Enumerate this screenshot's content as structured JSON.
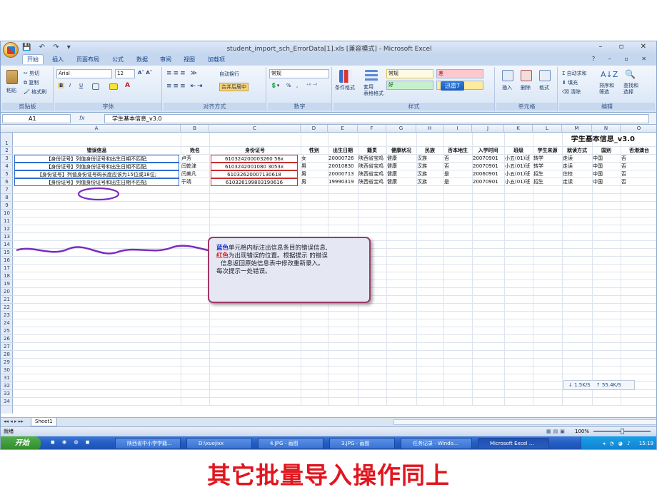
{
  "window": {
    "title": "student_import_sch_ErrorData[1].xls  [兼容模式] - Microsoft Excel",
    "controls": "– ▫ ✕",
    "qat": "💾 ↶ ↷ ▾"
  },
  "ribbon_tabs": [
    "开始",
    "插入",
    "页面布局",
    "公式",
    "数据",
    "审阅",
    "视图",
    "加载项"
  ],
  "ribbon_help": "? – ▫ ✕",
  "clipboard": {
    "paste": "粘贴",
    "cut": "剪切",
    "copy": "复制",
    "format_painter": "格式刷",
    "label": "剪贴板"
  },
  "font": {
    "name": "Arial",
    "size": "12",
    "bold": "B",
    "italic": "I",
    "underline": "U",
    "label": "字体"
  },
  "alignment": {
    "wrap": "自动换行",
    "merge": "合并后居中",
    "label": "对齐方式"
  },
  "number": {
    "format": "常规",
    "percent": "%",
    "comma": ",",
    "label": "数字"
  },
  "styles": {
    "cond": "条件格式",
    "table": "套用\n表格格式",
    "normal": "常规",
    "bad": "差",
    "good": "好",
    "label": "样式",
    "badge": "迅雷7"
  },
  "cells": {
    "insert": "插入",
    "delete": "删除",
    "format": "格式",
    "label": "单元格"
  },
  "editing": {
    "autosum": "自动求和",
    "fill": "填充",
    "clear": "清除",
    "sort": "排序和\n筛选",
    "find": "查找和\n选择",
    "label": "编辑"
  },
  "formula_bar": {
    "cell_ref": "A1",
    "fx": "fx",
    "content": "学生基本信息_v3.0"
  },
  "columns": [
    "A",
    "B",
    "C",
    "D",
    "E",
    "F",
    "G",
    "H",
    "I",
    "J",
    "K",
    "L",
    "M",
    "N",
    "O"
  ],
  "sheet_title": "学生基本信息_v3.0",
  "headers": [
    "错误信息",
    "姓名",
    "身份证号",
    "性别",
    "出生日期",
    "籍贯",
    "健康状况",
    "民族",
    "否本地生",
    "入学时间",
    "班级",
    "学生来源",
    "就读方式",
    "国别",
    "否港澳台"
  ],
  "rows": [
    [
      "【身份证号】列值身份证号和出生日期不匹配;",
      "卢芳",
      "610324200003260 56x",
      "女",
      "20000726",
      "陕西省宝鸡",
      "健康",
      "汉族",
      "否",
      "20070901",
      "小五(01)班",
      "转学",
      "走读",
      "中国",
      "否"
    ],
    [
      "【身份证号】列值身份证号和出生日期不匹配;",
      "闫乾津",
      "6103242001080 3053x",
      "男",
      "20010830",
      "陕西省宝鸡",
      "健康",
      "汉族",
      "否",
      "20070901",
      "小五(01)班",
      "转学",
      "走读",
      "中国",
      "否"
    ],
    [
      "【身份证号】列值身份证号码长度应该为15位或18位;",
      "闫美凡",
      "61032620007130618",
      "男",
      "20000713",
      "陕西省宝鸡",
      "健康",
      "汉族",
      "是",
      "20060901",
      "小五(01)班",
      "招生",
      "住校",
      "中国",
      "否"
    ],
    [
      "【身份证号】列值身份证号和出生日期不匹配;",
      "于靖",
      "610326199803190616",
      "男",
      "19990319",
      "陕西省宝鸡",
      "健康",
      "汉族",
      "是",
      "20070901",
      "小五(01)班",
      "招生",
      "走读",
      "中国",
      "否"
    ]
  ],
  "callout": {
    "l1a": "蓝色",
    "l1b": "单元格内标注出信息条目的错误信息,",
    "l2a": "红色",
    "l2b": "为出现错误的位置。根据提示 的错误",
    "l3": "信息返回原始信息表中修改重新录入。",
    "l4": "每次提示一处错误。"
  },
  "speed": {
    "down": "↓ 1.5K/S",
    "up": "↑ 55.4K/S"
  },
  "sheet_tab": "Sheet1",
  "status": {
    "ready": "就绪",
    "zoom": "100%"
  },
  "taskbar": {
    "start": "开始",
    "items": [
      "陕西省中小学学籍...",
      "D:\\xuejixx",
      "4.JPG - 画图",
      "3.JPG - 画图",
      "任务记录 - Windo...",
      "Microsoft Excel ..."
    ],
    "time": "15:19"
  },
  "caption": "其它批量导入操作同上"
}
